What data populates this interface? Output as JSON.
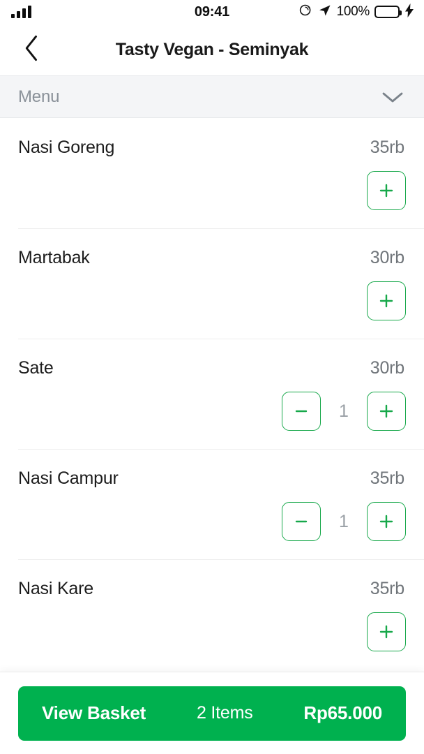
{
  "status_bar": {
    "signal_icon": "cellular-signal-icon",
    "time": "09:41",
    "rotation_lock_icon": "rotation-lock-icon",
    "location_icon": "location-arrow-icon",
    "battery_percent": "100%",
    "battery_icon": "battery-full-icon",
    "charging_icon": "lightning-bolt-icon",
    "battery_color": "#4cd964"
  },
  "navbar": {
    "back_icon": "chevron-left-icon",
    "title": "Tasty Vegan - Seminyak"
  },
  "menu_section": {
    "label": "Menu",
    "chevron_icon": "chevron-down-icon"
  },
  "theme": {
    "brand_green": "#00b14f",
    "outline_green": "#17a84a",
    "price_gray": "#70757a",
    "qty_gray": "#9aa0a6",
    "header_bg": "#f4f5f7"
  },
  "menu_items": [
    {
      "name": "Nasi Goreng",
      "price": "35rb",
      "quantity": null,
      "minus_label": "-",
      "plus_label": "+"
    },
    {
      "name": "Martabak",
      "price": "30rb",
      "quantity": null,
      "minus_label": "-",
      "plus_label": "+"
    },
    {
      "name": "Sate",
      "price": "30rb",
      "quantity": "1",
      "minus_label": "-",
      "plus_label": "+"
    },
    {
      "name": "Nasi Campur",
      "price": "35rb",
      "quantity": "1",
      "minus_label": "-",
      "plus_label": "+"
    },
    {
      "name": "Nasi Kare",
      "price": "35rb",
      "quantity": null,
      "minus_label": "-",
      "plus_label": "+"
    }
  ],
  "basket": {
    "label": "View Basket",
    "count": "2 Items",
    "total": "Rp65.000"
  }
}
